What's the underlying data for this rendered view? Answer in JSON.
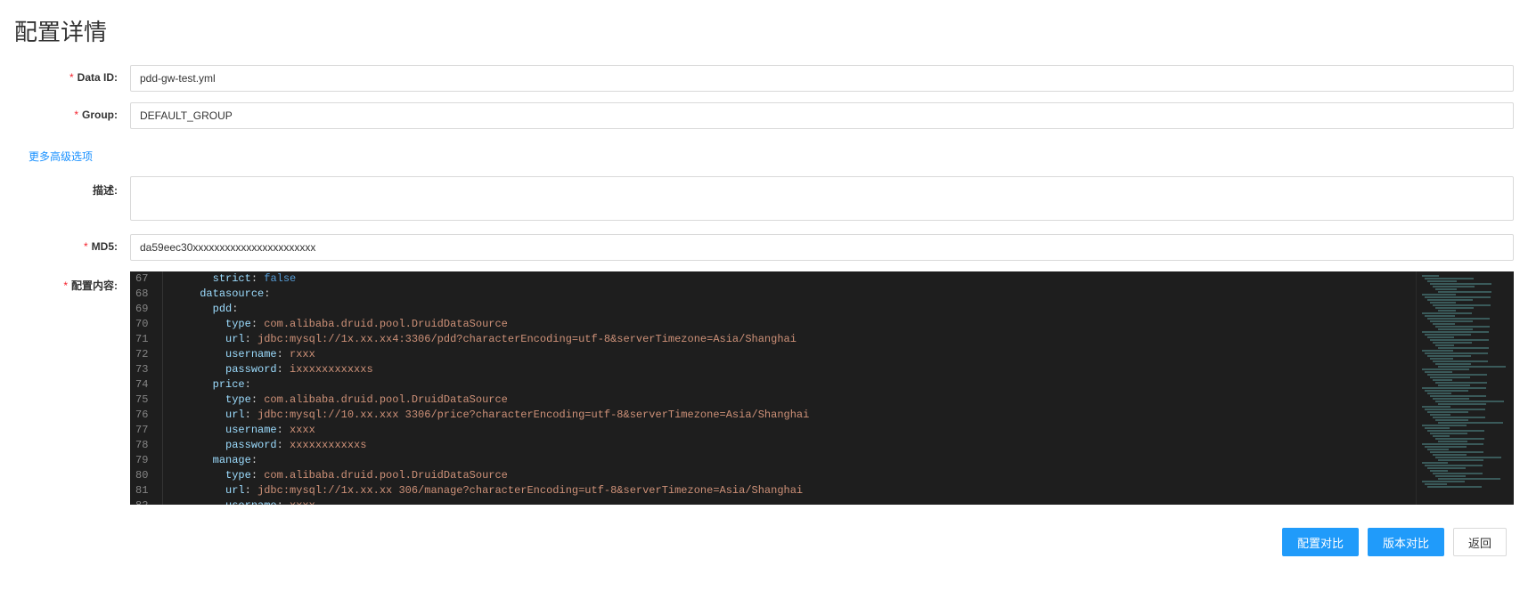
{
  "page": {
    "title": "配置详情"
  },
  "form": {
    "dataId": {
      "label": "Data ID:",
      "value": "pdd-gw-test.yml"
    },
    "group": {
      "label": "Group:",
      "value": "DEFAULT_GROUP"
    },
    "advancedLink": "更多高级选项",
    "description": {
      "label": "描述:",
      "value": ""
    },
    "md5": {
      "label": "MD5:",
      "value": "da59eec30xxxxxxxxxxxxxxxxxxxxxxx"
    },
    "content": {
      "label": "配置内容:"
    }
  },
  "code": {
    "startLine": 67,
    "lines": [
      {
        "indent": 6,
        "key": "strict",
        "value": "false",
        "valueType": "bool"
      },
      {
        "indent": 4,
        "key": "datasource",
        "value": "",
        "valueType": "none"
      },
      {
        "indent": 6,
        "key": "pdd",
        "value": "",
        "valueType": "none"
      },
      {
        "indent": 8,
        "key": "type",
        "value": "com.alibaba.druid.pool.DruidDataSource",
        "valueType": "str"
      },
      {
        "indent": 8,
        "key": "url",
        "value": "jdbc:mysql://1x.xx.xx4:3306/pdd?characterEncoding=utf-8&serverTimezone=Asia/Shanghai",
        "valueType": "str"
      },
      {
        "indent": 8,
        "key": "username",
        "value": "rxxx",
        "valueType": "str"
      },
      {
        "indent": 8,
        "key": "password",
        "value": "ixxxxxxxxxxxs",
        "valueType": "str"
      },
      {
        "indent": 6,
        "key": "price",
        "value": "",
        "valueType": "none"
      },
      {
        "indent": 8,
        "key": "type",
        "value": "com.alibaba.druid.pool.DruidDataSource",
        "valueType": "str"
      },
      {
        "indent": 8,
        "key": "url",
        "value": "jdbc:mysql://10.xx.xxx 3306/price?characterEncoding=utf-8&serverTimezone=Asia/Shanghai",
        "valueType": "str"
      },
      {
        "indent": 8,
        "key": "username",
        "value": "xxxx",
        "valueType": "str"
      },
      {
        "indent": 8,
        "key": "password",
        "value": "xxxxxxxxxxxs",
        "valueType": "str"
      },
      {
        "indent": 6,
        "key": "manage",
        "value": "",
        "valueType": "none"
      },
      {
        "indent": 8,
        "key": "type",
        "value": "com.alibaba.druid.pool.DruidDataSource",
        "valueType": "str"
      },
      {
        "indent": 8,
        "key": "url",
        "value": "jdbc:mysql://1x.xx.xx 306/manage?characterEncoding=utf-8&serverTimezone=Asia/Shanghai",
        "valueType": "str"
      },
      {
        "indent": 8,
        "key": "username",
        "value": "xxxx",
        "valueType": "str"
      }
    ]
  },
  "buttons": {
    "compareConfig": "配置对比",
    "compareVersion": "版本对比",
    "back": "返回"
  }
}
